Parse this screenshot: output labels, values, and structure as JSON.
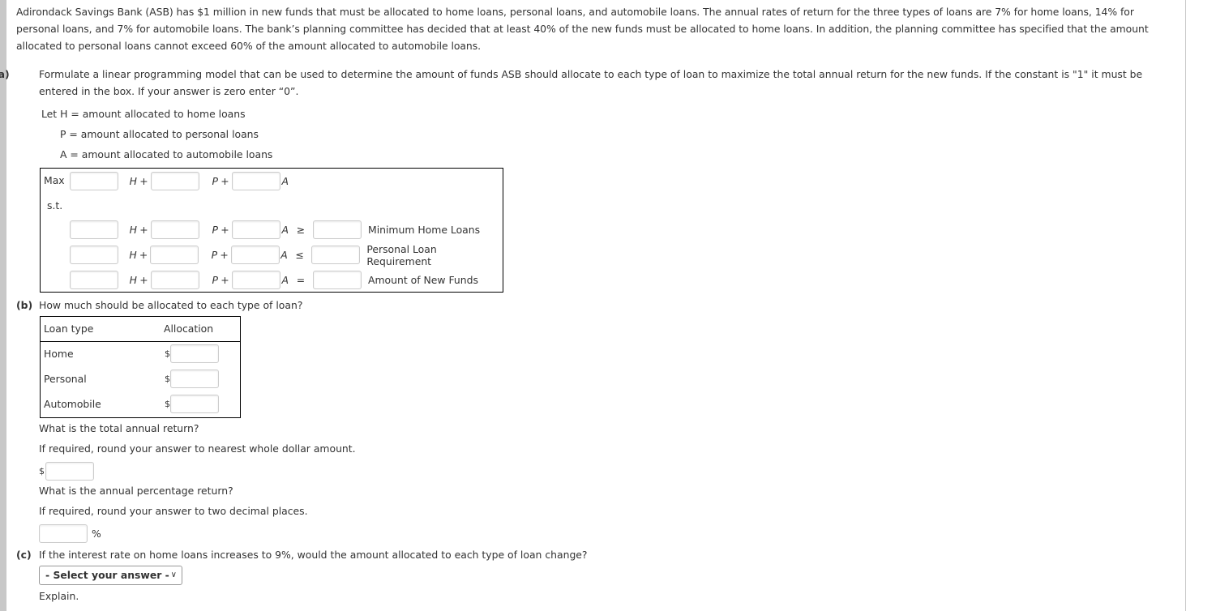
{
  "problem": {
    "intro": "Adirondack Savings Bank (ASB) has $1 million in new funds that must be allocated to home loans, personal loans, and automobile loans. The annual rates of return for the three types of loans are 7% for home loans, 14% for personal loans, and 7% for automobile loans. The bank’s planning committee has decided that at least 40% of the new funds must be allocated to home loans. In addition, the planning committee has specified that the amount allocated to personal loans cannot exceed 60% of the amount allocated to automobile loans."
  },
  "part_a": {
    "label": "(a)",
    "question": "Formulate a linear programming model that can be used to determine the amount of funds ASB should allocate to each type of loan to maximize the total annual return for the new funds. If the constant is \"1\" it must be entered in the box. If your answer is zero enter “0”.",
    "definitions": [
      {
        "prefix": "Let H",
        "text": " = amount allocated to home loans"
      },
      {
        "prefix": "P",
        "text": " = amount allocated to personal loans"
      },
      {
        "prefix": "A",
        "text": " = amount allocated to automobile loans"
      }
    ],
    "model": {
      "objective_label": "Max",
      "st_label": "s.t.",
      "vars": [
        "H",
        "P",
        "A"
      ],
      "plus": "+",
      "objective": {
        "coef_H": "",
        "coef_P": "",
        "coef_A": ""
      },
      "constraints": [
        {
          "coef_H": "",
          "coef_P": "",
          "coef_A": "",
          "relation": "≥",
          "rhs": "",
          "name": "Minimum Home Loans"
        },
        {
          "coef_H": "",
          "coef_P": "",
          "coef_A": "",
          "relation": "≤",
          "rhs": "",
          "name": "Personal Loan Requirement"
        },
        {
          "coef_H": "",
          "coef_P": "",
          "coef_A": "",
          "relation": "=",
          "rhs": "",
          "name": "Amount of New Funds"
        }
      ]
    }
  },
  "part_b": {
    "label": "(b)",
    "question": "How much should be allocated to each type of loan?",
    "table": {
      "headers": [
        "Loan type",
        "Allocation"
      ],
      "currency": "$",
      "rows": [
        {
          "type": "Home",
          "value": ""
        },
        {
          "type": "Personal",
          "value": ""
        },
        {
          "type": "Automobile",
          "value": ""
        }
      ]
    },
    "total_return_question": "What is the total annual return?",
    "total_return_hint": "If required, round your answer to nearest whole dollar amount.",
    "total_return_currency": "$",
    "total_return_value": "",
    "pct_return_question": "What is the annual percentage return?",
    "pct_return_hint": "If required, round your answer to two decimal places.",
    "pct_return_value": "",
    "pct_symbol": "%"
  },
  "part_c": {
    "label": "(c)",
    "question": "If the interest rate on home loans increases to 9%, would the amount allocated to each type of loan change?",
    "select_value": "- Select your answer -",
    "chevron_icon": "chevron-down-icon",
    "explain_label": "Explain."
  }
}
